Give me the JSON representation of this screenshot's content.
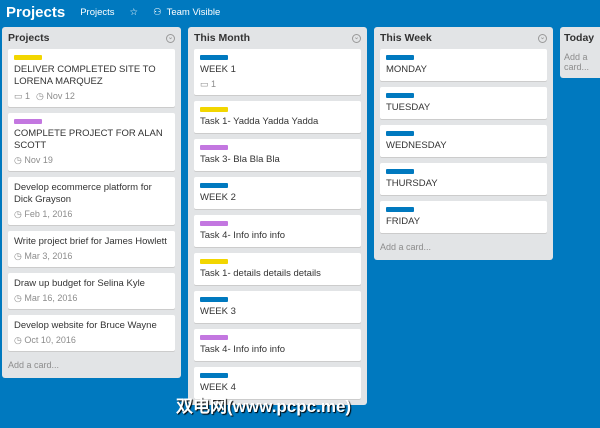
{
  "header": {
    "board_title": "Projects",
    "board_link": "Projects",
    "visibility": "Team Visible"
  },
  "colors": {
    "background": "#0079bf",
    "yellow": "#f2d600",
    "purple": "#c377e0",
    "blue": "#0079bf"
  },
  "lists": [
    {
      "title": "Projects",
      "add": "Add a card...",
      "cards": [
        {
          "label": "#f2d600",
          "title": "DELIVER COMPLETED SITE TO LORENA MARQUEZ",
          "comments": "1",
          "due": "Nov 12"
        },
        {
          "label": "#c377e0",
          "title": "COMPLETE PROJECT FOR ALAN SCOTT",
          "due": "Nov 19"
        },
        {
          "title": "Develop ecommerce platform for Dick Grayson",
          "due": "Feb 1, 2016"
        },
        {
          "title": "Write project brief for James Howlett",
          "due": "Mar 3, 2016"
        },
        {
          "title": "Draw up budget for Selina Kyle",
          "due": "Mar 16, 2016"
        },
        {
          "title": "Develop website for Bruce Wayne",
          "due": "Oct 10, 2016"
        }
      ]
    },
    {
      "title": "This Month",
      "cards": [
        {
          "label": "#0079bf",
          "title": "WEEK 1",
          "comments": "1"
        },
        {
          "label": "#f2d600",
          "title": "Task 1- Yadda Yadda Yadda"
        },
        {
          "label": "#c377e0",
          "title": "Task 3- Bla Bla Bla"
        },
        {
          "label": "#0079bf",
          "title": "WEEK 2"
        },
        {
          "label": "#c377e0",
          "title": "Task 4- Info info info"
        },
        {
          "label": "#f2d600",
          "title": "Task 1- details details details"
        },
        {
          "label": "#0079bf",
          "title": "WEEK 3"
        },
        {
          "label": "#c377e0",
          "title": "Task 4- Info info info"
        },
        {
          "label": "#0079bf",
          "title": "WEEK 4"
        }
      ]
    },
    {
      "title": "This Week",
      "add": "Add a card...",
      "cards": [
        {
          "label": "#0079bf",
          "title": "MONDAY"
        },
        {
          "label": "#0079bf",
          "title": "TUESDAY"
        },
        {
          "label": "#0079bf",
          "title": "WEDNESDAY"
        },
        {
          "label": "#0079bf",
          "title": "THURSDAY"
        },
        {
          "label": "#0079bf",
          "title": "FRIDAY"
        }
      ]
    },
    {
      "title": "Today",
      "add": "Add a card..."
    }
  ],
  "watermark": "双电网(www.pcpc.me)"
}
